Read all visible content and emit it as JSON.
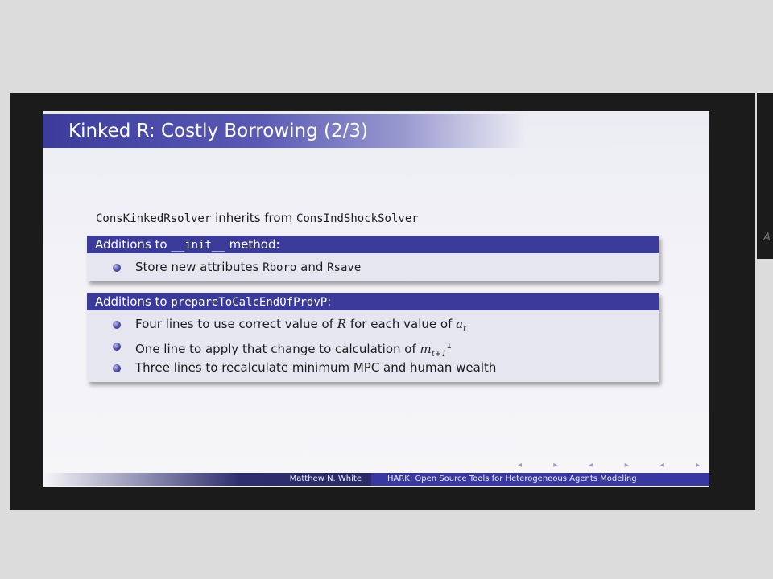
{
  "slide": {
    "title": "Kinked R: Costly Borrowing (2/3)",
    "intro": {
      "class_name": "ConsKinkedRsolver",
      "middle": " inherits from ",
      "parent_class": "ConsIndShockSolver"
    },
    "block1": {
      "header_prefix": "Additions to ",
      "header_code": "__init__",
      "header_suffix": " method:",
      "items": [
        {
          "pre": "Store new attributes ",
          "code1": "Rboro",
          "mid": " and ",
          "code2": "Rsave"
        }
      ]
    },
    "block2": {
      "header_prefix": "Additions to ",
      "header_code": "prepareToCalcEndOfPrdvP",
      "header_suffix": ":",
      "items": [
        {
          "pre": "Four lines to use correct value of ",
          "math1": "R",
          "mid": " for each value of ",
          "math2": "a",
          "sub2": "t"
        },
        {
          "pre": "One line to apply that change to calculation of ",
          "math1": "m",
          "sub1": "t+1",
          "sup1": "1"
        },
        {
          "text": "Three lines to recalculate minimum MPC and human wealth"
        }
      ]
    },
    "nav_symbols": "◂ ▸ ◂ ▸ ◂ ▸",
    "footer": {
      "author": "Matthew N. White",
      "talk": "HARK: Open Source Tools for Heterogeneous Agents Modeling"
    }
  },
  "side_panel": {
    "mark": "A"
  },
  "colors": {
    "accent": "#3a3a9a",
    "background": "#dcdcdc",
    "frame": "#1b1b1b",
    "slide": "#f2f2f7"
  }
}
